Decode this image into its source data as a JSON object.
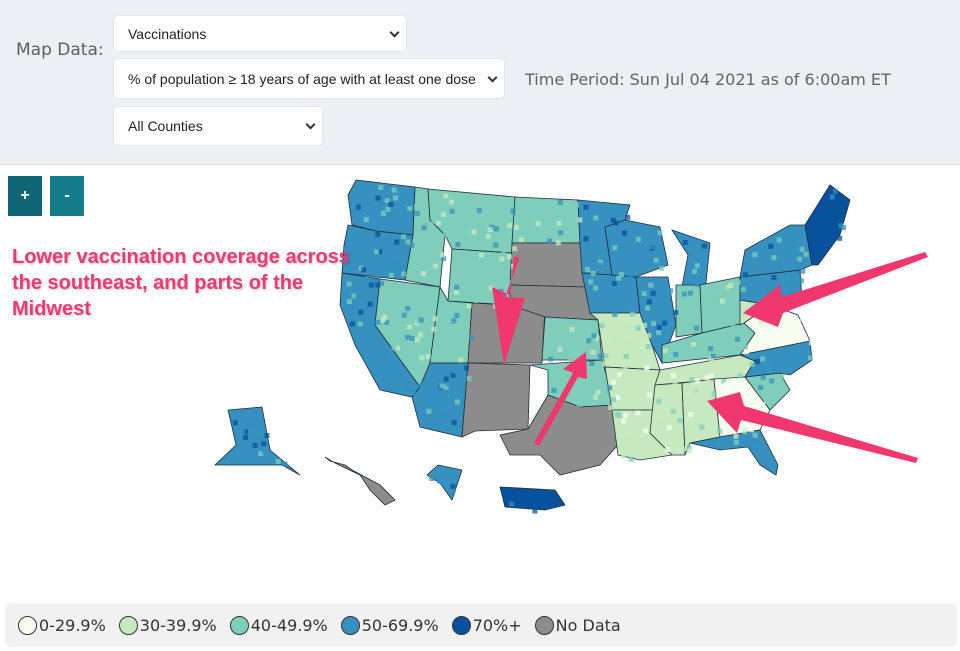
{
  "header": {
    "map_data_label": "Map Data:",
    "data_select": {
      "selected": "Vaccinations"
    },
    "metric_select": {
      "selected": "% of population ≥ 18 years of age with at least one dose"
    },
    "geo_select": {
      "selected": "All Counties"
    },
    "time_period": "Time Period: Sun Jul 04 2021 as of 6:00am ET"
  },
  "zoom_controls": {
    "zoom_in": "+",
    "zoom_out": "-"
  },
  "annotation": {
    "text": "Lower vaccination coverage across the southeast, and parts of the Midwest",
    "color": "#ee3a73"
  },
  "legend": [
    {
      "label": "0-29.9%",
      "color": "#f7fcf0"
    },
    {
      "label": "30-39.9%",
      "color": "#c7e9c0"
    },
    {
      "label": "40-49.9%",
      "color": "#7fcdbb"
    },
    {
      "label": "50-69.9%",
      "color": "#3690c0"
    },
    {
      "label": "70%+",
      "color": "#08519c"
    },
    {
      "label": "No Data",
      "color": "#8c8c8c"
    }
  ],
  "map": {
    "regions": [
      {
        "name": "washington",
        "category": "50-69.9%"
      },
      {
        "name": "oregon",
        "category": "50-69.9%"
      },
      {
        "name": "california",
        "category": "50-69.9%"
      },
      {
        "name": "nevada",
        "category": "40-49.9%"
      },
      {
        "name": "idaho",
        "category": "40-49.9%"
      },
      {
        "name": "montana",
        "category": "40-49.9%"
      },
      {
        "name": "wyoming",
        "category": "40-49.9%"
      },
      {
        "name": "utah",
        "category": "40-49.9%"
      },
      {
        "name": "arizona",
        "category": "50-69.9%"
      },
      {
        "name": "colorado",
        "category": "No Data"
      },
      {
        "name": "new-mexico",
        "category": "No Data"
      },
      {
        "name": "north-dakota",
        "category": "40-49.9%"
      },
      {
        "name": "south-dakota",
        "category": "No Data"
      },
      {
        "name": "nebraska",
        "category": "No Data"
      },
      {
        "name": "kansas",
        "category": "40-49.9%"
      },
      {
        "name": "oklahoma",
        "category": "40-49.9%"
      },
      {
        "name": "texas",
        "category": "No Data"
      },
      {
        "name": "minnesota",
        "category": "50-69.9%"
      },
      {
        "name": "iowa",
        "category": "50-69.9%"
      },
      {
        "name": "missouri",
        "category": "30-39.9%"
      },
      {
        "name": "arkansas",
        "category": "30-39.9%"
      },
      {
        "name": "louisiana",
        "category": "30-39.9%"
      },
      {
        "name": "wisconsin",
        "category": "50-69.9%"
      },
      {
        "name": "illinois",
        "category": "50-69.9%"
      },
      {
        "name": "michigan",
        "category": "50-69.9%"
      },
      {
        "name": "indiana",
        "category": "40-49.9%"
      },
      {
        "name": "ohio",
        "category": "40-49.9%"
      },
      {
        "name": "kentucky",
        "category": "40-49.9%"
      },
      {
        "name": "tennessee",
        "category": "30-39.9%"
      },
      {
        "name": "mississippi",
        "category": "30-39.9%"
      },
      {
        "name": "alabama",
        "category": "30-39.9%"
      },
      {
        "name": "georgia",
        "category": "0-29.9%"
      },
      {
        "name": "florida",
        "category": "50-69.9%"
      },
      {
        "name": "south-carolina",
        "category": "40-49.9%"
      },
      {
        "name": "north-carolina",
        "category": "50-69.9%"
      },
      {
        "name": "virginia",
        "category": "0-29.9%"
      },
      {
        "name": "west-virginia",
        "category": "30-39.9%"
      },
      {
        "name": "pennsylvania",
        "category": "50-69.9%"
      },
      {
        "name": "new-york",
        "category": "50-69.9%"
      },
      {
        "name": "new-england",
        "category": "70%+"
      },
      {
        "name": "alaska",
        "category": "50-69.9%"
      },
      {
        "name": "hawaii",
        "category": "No Data"
      },
      {
        "name": "district-of-columbia",
        "category": "50-69.9%"
      },
      {
        "name": "puerto-rico",
        "category": "70%+"
      }
    ]
  }
}
